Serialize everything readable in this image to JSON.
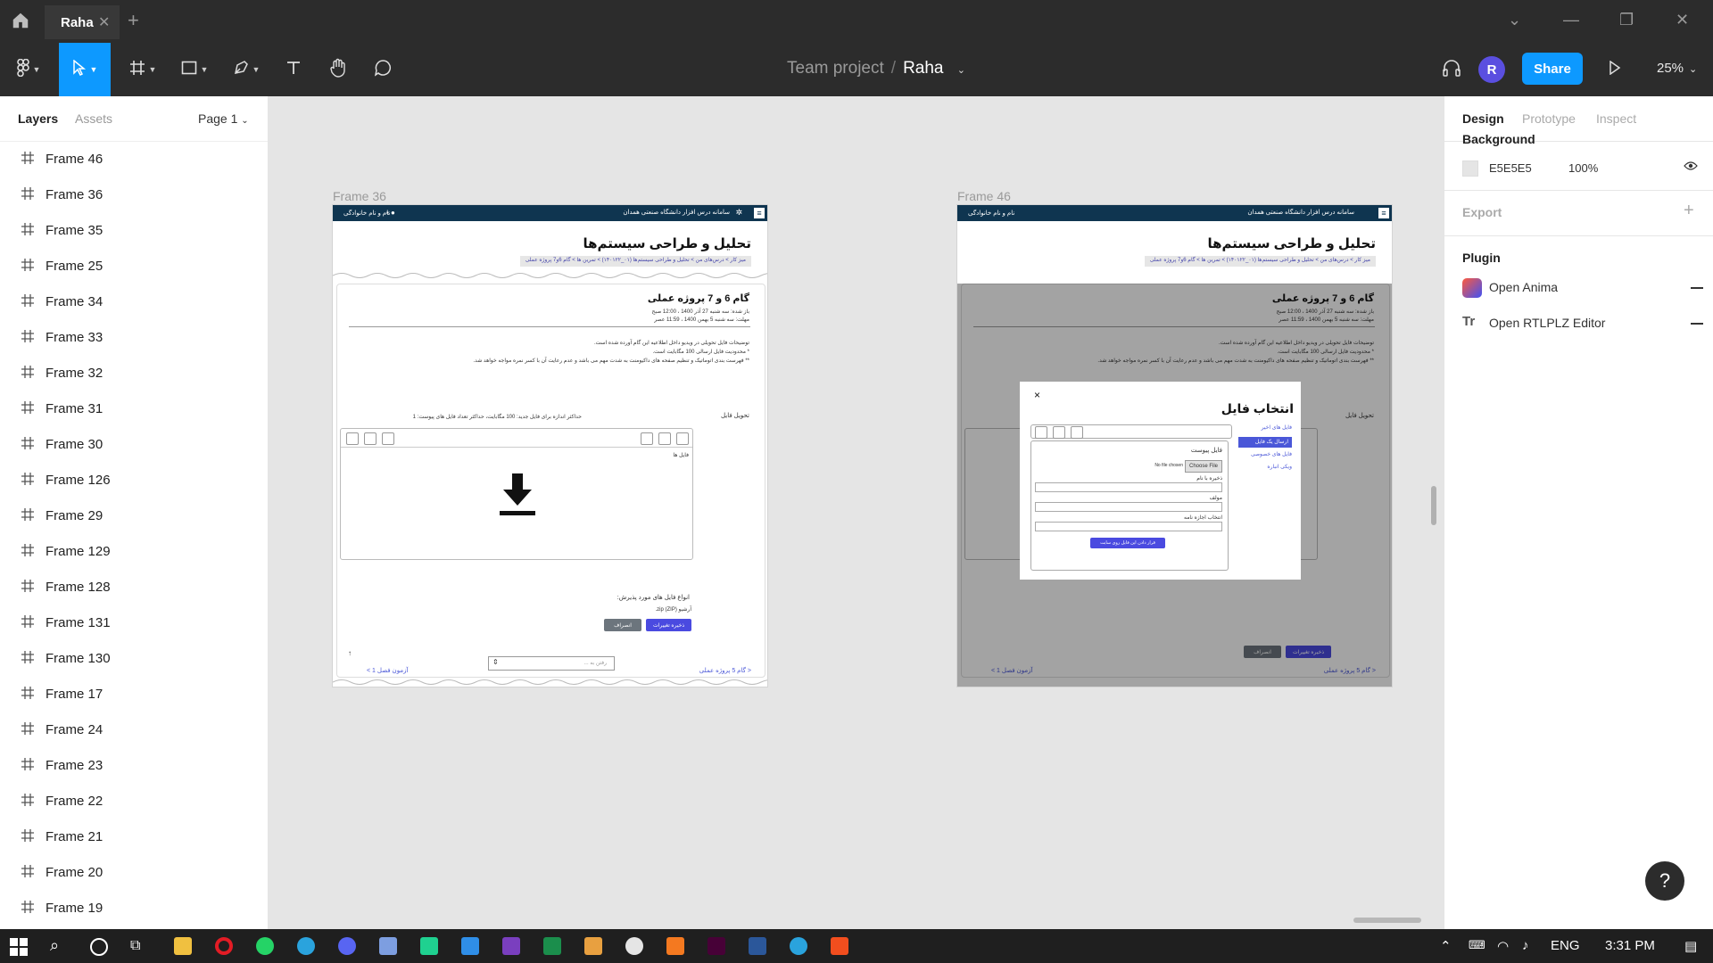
{
  "window": {
    "tab_title": "Raha"
  },
  "toolbar": {
    "project": "Team project",
    "separator": "/",
    "file": "Raha",
    "avatar_initial": "R",
    "share_label": "Share",
    "zoom": "25%"
  },
  "left_panel": {
    "tabs": [
      "Layers",
      "Assets"
    ],
    "page_selector": "Page 1",
    "layers": [
      "Frame 46",
      "Frame 36",
      "Frame 35",
      "Frame 25",
      "Frame 34",
      "Frame 33",
      "Frame 32",
      "Frame 31",
      "Frame 30",
      "Frame 126",
      "Frame 29",
      "Frame 129",
      "Frame 128",
      "Frame 131",
      "Frame 130",
      "Frame 17",
      "Frame 24",
      "Frame 23",
      "Frame 22",
      "Frame 21",
      "Frame 20",
      "Frame 19"
    ]
  },
  "canvas": {
    "frames": [
      {
        "label": "Frame 36",
        "header_title": "سامانه درس افزار دانشگاه صنعتی همدان",
        "header_user": "نام و نام خانوادگی",
        "page_title": "تحلیل و طراحی سیستم‌ها",
        "breadcrumb": "میز کار  >  درس‌های من  >  تحلیل و طراحی سیستم‌ها (۰۱_۱۴۰۱۲۲)  >  تمرین ها  >  گام 6و7 پروژه عملی",
        "section_title": "گام 6 و 7 پروژه عملی",
        "opened": "باز شده: سه شنبه 27 آذر 1400 ، 12:00 صبح",
        "due": "مهلت: سه شنبه 5 بهمن 1400 ، 11:59 عصر",
        "note1": "توضیحات فایل تحویلی در ویدیو داخل اطلاعیه این گام آورده شده است.",
        "note2": "* محدودیت فایل ارسالی 100 مگابایت است.",
        "note3": "** فهرست بندی اتوماتیک و تنظیم صفحه های داکیومنت به شدت مهم می باشد و عدم رعایت آن با کسر نمره مواجه خواهد شد.",
        "submission_label": "تحویل فایل",
        "limits": "حداکثر اندازه برای فایل جدید: 100 مگابایت، حداکثر تعداد فایل های پیوست: 1",
        "files_folder": "فایل ها",
        "accepted_types_title": "انواع فایل های مورد پذیرش:",
        "archive_label": "آرشیو (ZIP)",
        "zip_ext": "zip.",
        "save_btn": "ذخیره تغییرات",
        "cancel_btn": "انصراف",
        "prev_link": "< گام 5 پروژه عملی",
        "next_link": "آزمون فصل 1 >",
        "jump_placeholder": "رفتن به ...",
        "up_arrow": "↑"
      },
      {
        "label": "Frame 46",
        "modal": {
          "title": "انتخاب فایل",
          "close": "×",
          "menu": [
            "فایل های اخیر",
            "ارسال یک فایل",
            "فایل های خصوصی",
            "ویکی انباره"
          ],
          "attachment_label": "فایل پیوست",
          "no_file": "No file chosen",
          "choose_file": "Choose File",
          "save_as": "ذخیره با نام",
          "author": "مولف",
          "license": "انتخاب اجازه نامه",
          "upload_btn": "قرار دادن این فایل روی سایت"
        }
      }
    ]
  },
  "right_panel": {
    "tabs": [
      "Design",
      "Prototype",
      "Inspect"
    ],
    "background_title": "Background",
    "background_hex": "E5E5E5",
    "background_opacity": "100%",
    "export_title": "Export",
    "plugin_title": "Plugin",
    "plugins": [
      "Open Anima",
      "Open RTLPLZ Editor"
    ]
  },
  "taskbar": {
    "language": "ENG",
    "time": "3:31 PM"
  },
  "colors": {
    "accent": "#0d99ff",
    "canvas": "#e5e5e5",
    "frame_header": "#0f3550",
    "link_blue": "#4a57d8",
    "save_button": "#4a4ae0",
    "cancel_button": "#6c757d"
  }
}
